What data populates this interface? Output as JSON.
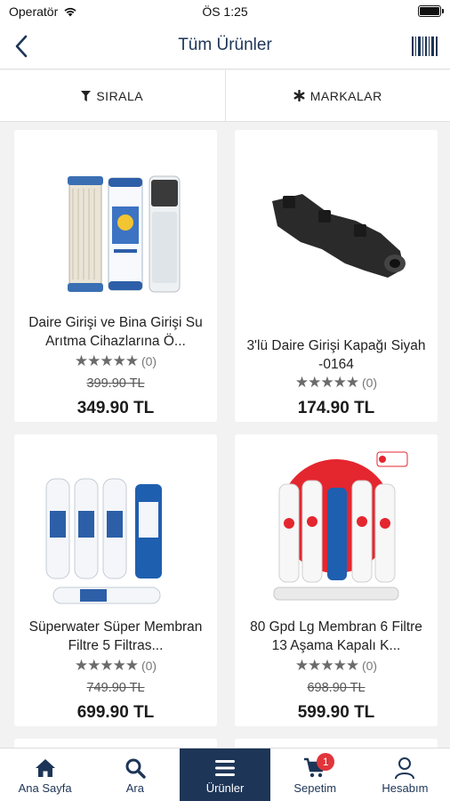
{
  "status_bar": {
    "carrier": "Operatör",
    "time": "ÖS 1:25"
  },
  "nav": {
    "title": "Tüm Ürünler",
    "back_icon": "chevron-left-icon",
    "barcode_icon": "barcode-icon"
  },
  "filters": {
    "sort_label": "SIRALA",
    "brands_label": "MARKALAR"
  },
  "products": [
    {
      "name": "Daire Girişi ve Bina Girişi Su Arıtma Cihazlarına Ö...",
      "rating_count": "(0)",
      "old_price": "399.90 TL",
      "price": "349.90 TL",
      "stars": "★★★★★"
    },
    {
      "name": "3'lü Daire Girişi Kapağı Siyah -0164",
      "rating_count": "(0)",
      "old_price": "",
      "price": "174.90 TL",
      "stars": "★★★★★"
    },
    {
      "name": "Süperwater Süper Membran Filtre 5 Filtras...",
      "rating_count": "(0)",
      "old_price": "749.90 TL",
      "price": "699.90 TL",
      "stars": "★★★★★"
    },
    {
      "name": "80 Gpd Lg Membran 6 Filtre 13 Aşama Kapalı K...",
      "rating_count": "(0)",
      "old_price": "698.90 TL",
      "price": "599.90 TL",
      "stars": "★★★★★"
    }
  ],
  "tabs": [
    {
      "label": "Ana Sayfa",
      "icon": "home-icon"
    },
    {
      "label": "Ara",
      "icon": "search-icon"
    },
    {
      "label": "Ürünler",
      "icon": "menu-icon"
    },
    {
      "label": "Sepetim",
      "icon": "cart-icon",
      "badge": "1"
    },
    {
      "label": "Hesabım",
      "icon": "user-icon"
    }
  ],
  "colors": {
    "brand": "#1d3557",
    "badge": "#e0353b",
    "background": "#f2f2f2"
  }
}
